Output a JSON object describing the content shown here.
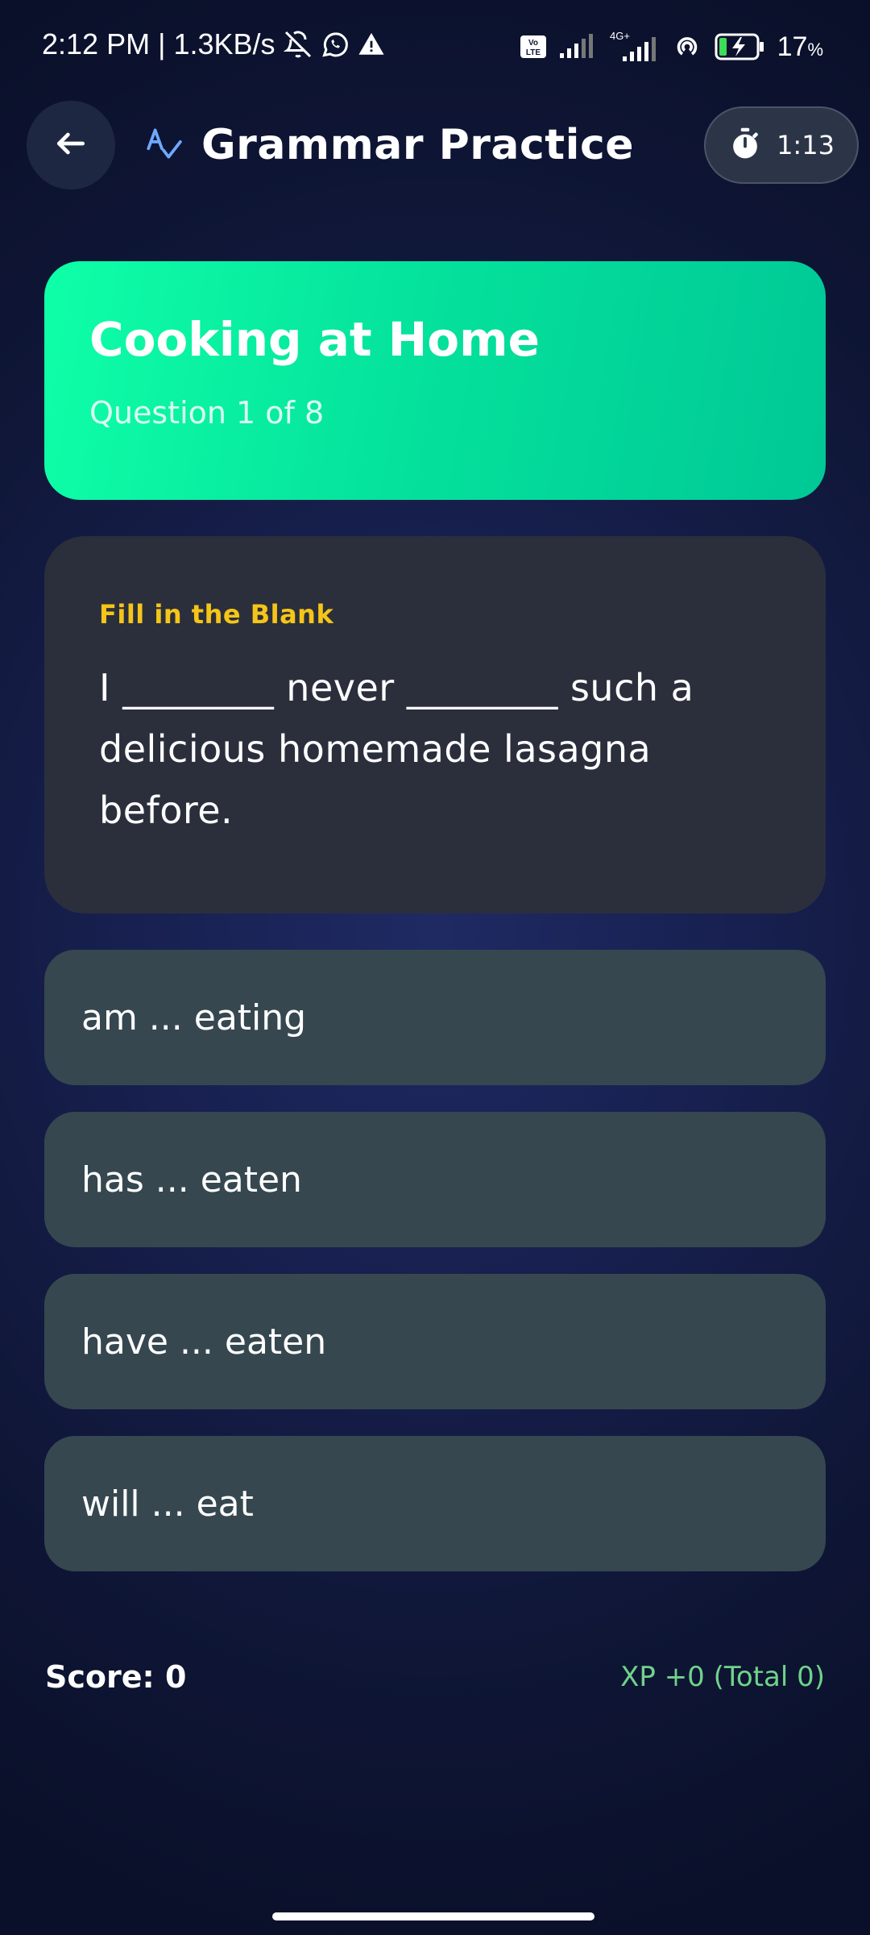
{
  "status_bar": {
    "time": "2:12 PM",
    "speed": "1.3KB/s",
    "separator": "|",
    "battery_percent": "17",
    "battery_suffix": "%",
    "network_label": "4G+",
    "icons": [
      "mute-bell-icon",
      "whatsapp-icon",
      "alert-icon",
      "volte-icon",
      "signal-icon",
      "signal-4g-icon",
      "hotspot-icon",
      "battery-charging-icon"
    ]
  },
  "header": {
    "title": "Grammar Practice",
    "timer": "1:13",
    "icons": [
      "back-arrow-icon",
      "spellcheck-icon",
      "stopwatch-icon"
    ]
  },
  "topic": {
    "title": "Cooking at Home",
    "progress": "Question 1 of 8",
    "current": 1,
    "total": 8
  },
  "question": {
    "type": "Fill in the Blank",
    "text": "I ________ never ________ such a delicious homemade lasagna before."
  },
  "options": [
    {
      "label": "am ... eating"
    },
    {
      "label": "has ... eaten"
    },
    {
      "label": "have ... eaten"
    },
    {
      "label": "will ... eat"
    }
  ],
  "footer": {
    "score": "Score: 0",
    "xp": "XP +0 (Total 0)"
  },
  "colors": {
    "accent_green": "#05e39c",
    "question_type": "#f5c518",
    "xp_text": "#6fd38a",
    "option_bg": "#36474f",
    "card_bg": "#2b2f3c"
  }
}
